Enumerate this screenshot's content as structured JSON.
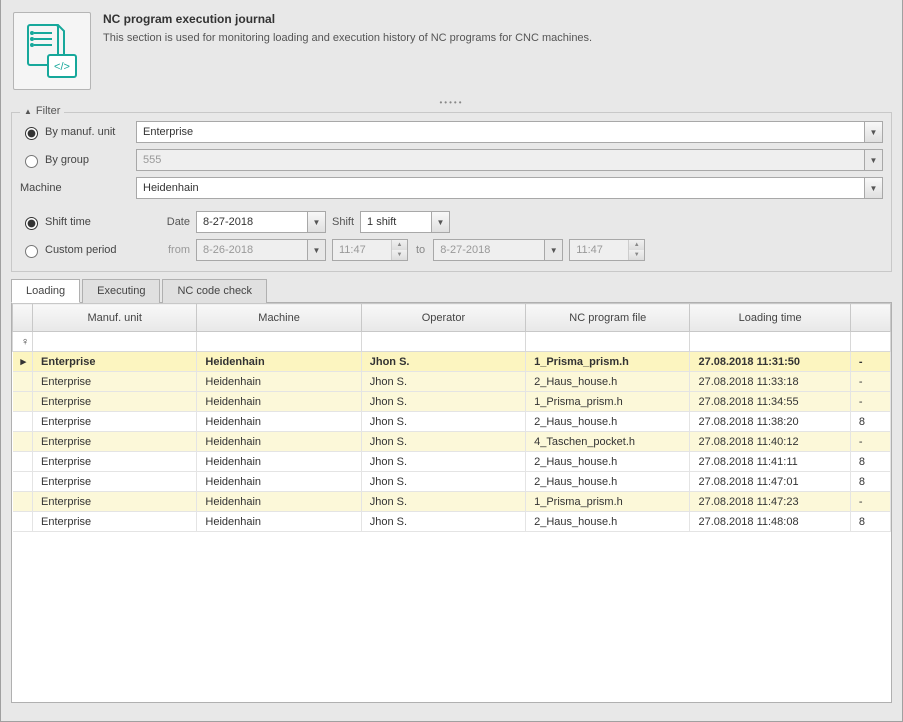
{
  "header": {
    "title": "NC program execution journal",
    "desc": "This section is used for monitoring loading and execution history of NC programs for CNC machines."
  },
  "filter": {
    "legend": "Filter",
    "by_manuf_label": "By manuf. unit",
    "by_group_label": "By group",
    "manuf_value": "Enterprise",
    "group_value": "555",
    "machine_label": "Machine",
    "machine_value": "Heidenhain",
    "shift_time_label": "Shift time",
    "custom_period_label": "Custom period",
    "date_label": "Date",
    "date_value": "8-27-2018",
    "shift_label": "Shift",
    "shift_value": "1 shift",
    "from_label": "from",
    "from_date": "8-26-2018",
    "from_time": "11:47",
    "to_label": "to",
    "to_date": "8-27-2018",
    "to_time": "11:47"
  },
  "tabs": {
    "loading": "Loading",
    "executing": "Executing",
    "nccheck": "NC code check"
  },
  "grid": {
    "columns": {
      "manuf_unit": "Manuf. unit",
      "machine": "Machine",
      "operator": "Operator",
      "nc_file": "NC program file",
      "loading_time": "Loading time",
      "extra": ""
    },
    "rows": [
      {
        "sel": true,
        "hl": true,
        "manuf": "Enterprise",
        "machine": "Heidenhain",
        "op": "Jhon S.",
        "file": "1_Prisma_prism.h",
        "time": "27.08.2018 11:31:50",
        "ext": "-"
      },
      {
        "sel": false,
        "hl": true,
        "manuf": "Enterprise",
        "machine": "Heidenhain",
        "op": "Jhon S.",
        "file": "2_Haus_house.h",
        "time": "27.08.2018 11:33:18",
        "ext": "-"
      },
      {
        "sel": false,
        "hl": true,
        "manuf": "Enterprise",
        "machine": "Heidenhain",
        "op": "Jhon S.",
        "file": "1_Prisma_prism.h",
        "time": "27.08.2018 11:34:55",
        "ext": "-"
      },
      {
        "sel": false,
        "hl": false,
        "manuf": "Enterprise",
        "machine": "Heidenhain",
        "op": "Jhon S.",
        "file": "2_Haus_house.h",
        "time": "27.08.2018 11:38:20",
        "ext": "8"
      },
      {
        "sel": false,
        "hl": true,
        "manuf": "Enterprise",
        "machine": "Heidenhain",
        "op": "Jhon S.",
        "file": "4_Taschen_pocket.h",
        "time": "27.08.2018 11:40:12",
        "ext": "-"
      },
      {
        "sel": false,
        "hl": false,
        "manuf": "Enterprise",
        "machine": "Heidenhain",
        "op": "Jhon S.",
        "file": "2_Haus_house.h",
        "time": "27.08.2018 11:41:11",
        "ext": "8"
      },
      {
        "sel": false,
        "hl": false,
        "manuf": "Enterprise",
        "machine": "Heidenhain",
        "op": "Jhon S.",
        "file": "2_Haus_house.h",
        "time": "27.08.2018 11:47:01",
        "ext": "8"
      },
      {
        "sel": false,
        "hl": true,
        "manuf": "Enterprise",
        "machine": "Heidenhain",
        "op": "Jhon S.",
        "file": "1_Prisma_prism.h",
        "time": "27.08.2018 11:47:23",
        "ext": "-"
      },
      {
        "sel": false,
        "hl": false,
        "manuf": "Enterprise",
        "machine": "Heidenhain",
        "op": "Jhon S.",
        "file": "2_Haus_house.h",
        "time": "27.08.2018 11:48:08",
        "ext": "8"
      }
    ]
  }
}
